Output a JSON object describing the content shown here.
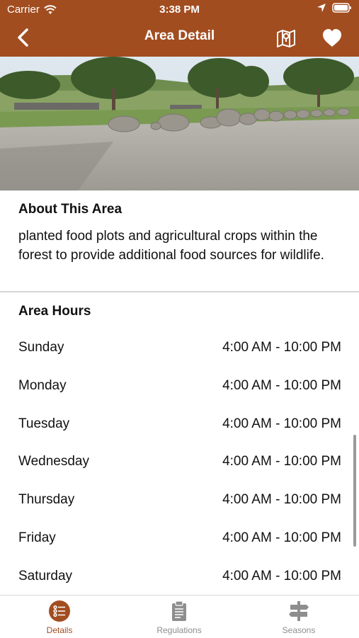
{
  "status_bar": {
    "carrier": "Carrier",
    "time": "3:38 PM"
  },
  "nav": {
    "title": "Area Detail"
  },
  "about": {
    "heading": "About This Area",
    "text": "planted food plots and agricultural crops within the forest to provide additional food sources for wildlife."
  },
  "hours": {
    "heading": "Area Hours",
    "rows": [
      {
        "day": "Sunday",
        "time": "4:00 AM - 10:00 PM"
      },
      {
        "day": "Monday",
        "time": "4:00 AM - 10:00 PM"
      },
      {
        "day": "Tuesday",
        "time": "4:00 AM - 10:00 PM"
      },
      {
        "day": "Wednesday",
        "time": "4:00 AM - 10:00 PM"
      },
      {
        "day": "Thursday",
        "time": "4:00 AM - 10:00 PM"
      },
      {
        "day": "Friday",
        "time": "4:00 AM - 10:00 PM"
      },
      {
        "day": "Saturday",
        "time": "4:00 AM - 10:00 PM"
      }
    ]
  },
  "tabs": [
    {
      "label": "Details",
      "icon": "list-icon",
      "active": true
    },
    {
      "label": "Regulations",
      "icon": "clipboard-icon",
      "active": false
    },
    {
      "label": "Seasons",
      "icon": "signpost-icon",
      "active": false
    }
  ],
  "colors": {
    "brand": "#a24d20",
    "tab_inactive": "#8e8e8e"
  }
}
